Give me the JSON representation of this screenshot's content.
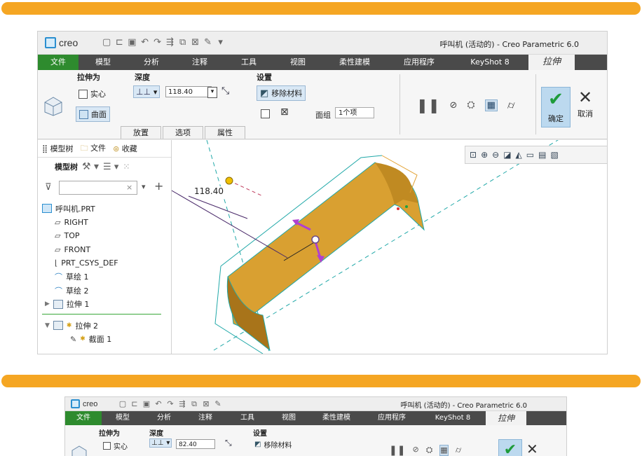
{
  "colors": {
    "accent_bar": "#f5a623",
    "file_tab": "#2e8b2e",
    "menubar": "#4a4a4a",
    "model": "#d9a031",
    "edge": "#20a8a8"
  },
  "window": {
    "logo": "creo",
    "title": "呼叫机 (活动的) - Creo Parametric 6.0",
    "quick_access_icons": [
      "new-icon",
      "open-icon",
      "save-icon",
      "undo-icon",
      "redo-icon",
      "regenerate-icon",
      "windows-icon",
      "close-window-icon",
      "settings-icon"
    ]
  },
  "menubar": [
    "文件",
    "模型",
    "分析",
    "注释",
    "工具",
    "视图",
    "柔性建模",
    "应用程序",
    "KeyShot 8",
    "拉伸"
  ],
  "ribbon": {
    "extrude_as": "拉伸为",
    "solid": "实心",
    "surface": "曲面",
    "depth": "深度",
    "depth_value": "118.40",
    "settings": "设置",
    "remove_material": "移除材料",
    "face_group": "面组",
    "face_group_value": "1个项",
    "tabs": [
      "放置",
      "选项",
      "属性"
    ],
    "ok": "确定",
    "cancel": "取消"
  },
  "panel": {
    "tabs": [
      "模型树",
      "文件",
      "收藏"
    ],
    "tree_title": "模型树",
    "filter_placeholder": "",
    "tree": {
      "root": "呼叫机.PRT",
      "right": "RIGHT",
      "top": "TOP",
      "front": "FRONT",
      "csys": "PRT_CSYS_DEF",
      "sketch1": "草绘 1",
      "sketch2": "草绘 2",
      "extrude1": "拉伸 1",
      "extrude2": "拉伸 2",
      "section1": "截面 1"
    }
  },
  "viewport": {
    "dimension": "118.40",
    "toolbar_icons": [
      "refit-icon",
      "zoom-in-icon",
      "zoom-out-icon",
      "repaint-icon",
      "display-style-icon",
      "view-manager-icon",
      "saved-views-icon",
      "datum-display-icon"
    ]
  },
  "shot2": {
    "title": "呼叫机 (活动的) - Creo Parametric 6.0",
    "depth_value": "82.40"
  }
}
